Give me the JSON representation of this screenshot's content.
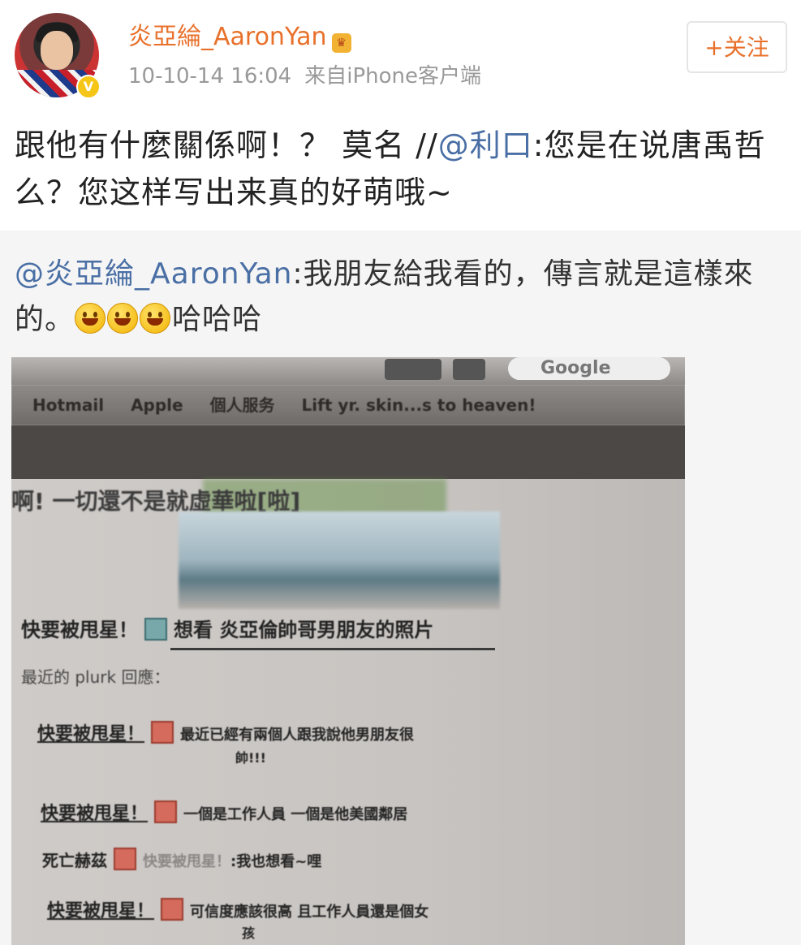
{
  "post": {
    "username": "炎亞綸_AaronYan",
    "timestamp": "10-10-14 16:04",
    "source": "来自iPhone客户端",
    "follow_label": "+关注",
    "text_main": "跟他有什麼關係啊！？ 莫名 //",
    "text_mention": "@利口",
    "text_rest": ":您是在说唐禹哲么？您这样写出来真的好萌哦~"
  },
  "repost": {
    "mention": "@炎亞綸_AaronYan",
    "text": ":我朋友給我看的，傳言就是這樣來的。",
    "laugh": "哈哈哈",
    "emoji_count": 3
  },
  "photo": {
    "search_text": "Google",
    "bookmarks": [
      "Hotmail",
      "Apple",
      "個人服务",
      "Lift yr. skin...s to heaven!"
    ],
    "banner": "啊! 一切還不是就虛華啦[啦]",
    "line1_user": "快要被甩星！",
    "line1_text": "想看 炎亞倫帥哥男朋友的照片",
    "recent_label": "最近的 plurk 回應：",
    "reply1_user": "快要被甩星！",
    "reply1_text": "最近已經有兩個人跟我說他男朋友很",
    "reply1_text2": "帥!!!",
    "reply2_user": "快要被甩星！",
    "reply2_text": "一個是工作人員 一個是他美國鄰居",
    "reply3_user": "死亡赫茲",
    "reply3_faded": "快要被甩星！",
    "reply3_text": ":我也想看~哩",
    "reply4_user": "快要被甩星！",
    "reply4_text": "可信度應該很高 且工作人員還是個女",
    "reply4_text2": "孩"
  },
  "colors": {
    "username": "#e8702a",
    "mention": "#4a6fa5",
    "meta": "#999999",
    "repost_bg": "#f5f5f5"
  },
  "icons": [
    "verified-badge-icon",
    "crown-icon",
    "smiley-icon"
  ]
}
